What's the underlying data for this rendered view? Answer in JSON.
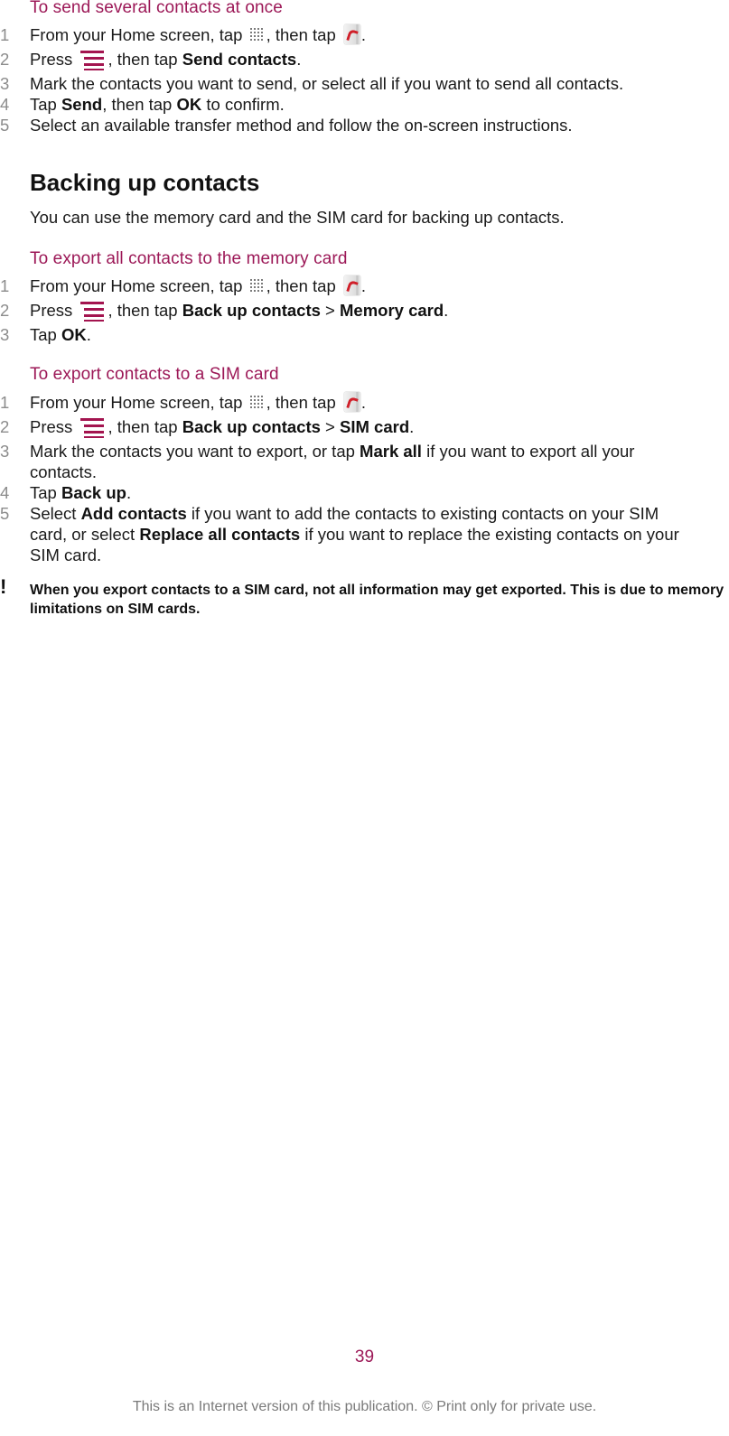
{
  "colors": {
    "accent": "#9c1857",
    "step_number": "#8c8c8c",
    "footer": "#7a7a7a"
  },
  "icons": {
    "apps": "apps-grid-icon",
    "contacts": "contacts-app-icon",
    "menu": "menu-key-icon",
    "note": "exclamation-icon"
  },
  "section1": {
    "title": "To send several contacts at once",
    "steps": [
      {
        "num": "1",
        "parts": [
          "From your Home screen, tap ",
          ", then tap ",
          "."
        ]
      },
      {
        "num": "2",
        "parts": [
          "Press ",
          ", then tap ",
          "Send contacts",
          "."
        ]
      },
      {
        "num": "3",
        "text": "Mark the contacts you want to send, or select all if you want to send all contacts."
      },
      {
        "num": "4",
        "parts": [
          "Tap ",
          "Send",
          ", then tap ",
          "OK",
          " to confirm."
        ]
      },
      {
        "num": "5",
        "text": "Select an available transfer method and follow the on-screen instructions."
      }
    ]
  },
  "section2": {
    "heading": "Backing up contacts",
    "intro": "You can use the memory card and the SIM card for backing up contacts."
  },
  "section3": {
    "title": "To export all contacts to the memory card",
    "steps": [
      {
        "num": "1",
        "parts": [
          "From your Home screen, tap ",
          ", then tap ",
          "."
        ]
      },
      {
        "num": "2",
        "parts": [
          "Press ",
          ", then tap ",
          "Back up contacts",
          " > ",
          "Memory card",
          "."
        ]
      },
      {
        "num": "3",
        "parts": [
          "Tap ",
          "OK",
          "."
        ]
      }
    ]
  },
  "section4": {
    "title": "To export contacts to a SIM card",
    "steps": [
      {
        "num": "1",
        "parts": [
          "From your Home screen, tap ",
          ", then tap ",
          "."
        ]
      },
      {
        "num": "2",
        "parts": [
          "Press ",
          ", then tap ",
          "Back up contacts",
          " > ",
          "SIM card",
          "."
        ]
      },
      {
        "num": "3",
        "parts": [
          "Mark the contacts you want to export, or tap ",
          "Mark all",
          " if you want to export all your contacts."
        ]
      },
      {
        "num": "4",
        "parts": [
          "Tap ",
          "Back up",
          "."
        ]
      },
      {
        "num": "5",
        "parts": [
          "Select ",
          "Add contacts",
          " if you want to add the contacts to existing contacts on your SIM card, or select ",
          "Replace all contacts",
          " if you want to replace the existing contacts on your SIM card."
        ]
      }
    ],
    "note": "When you export contacts to a SIM card, not all information may get exported. This is due to memory limitations on SIM cards.",
    "note_icon": "!"
  },
  "footer": {
    "page_number": "39",
    "notice": "This is an Internet version of this publication. © Print only for private use."
  }
}
